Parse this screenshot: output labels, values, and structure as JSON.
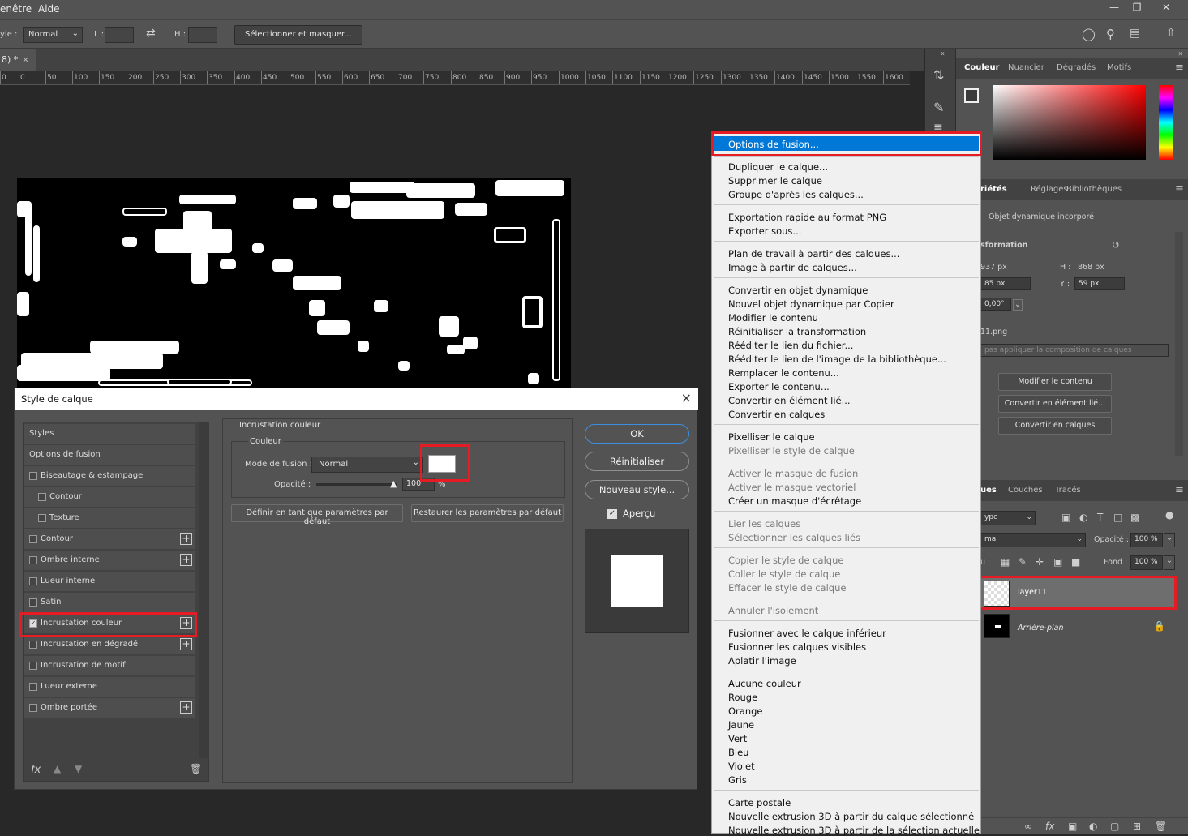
{
  "menubar": {
    "items": [
      "enêtre",
      "Aide"
    ]
  },
  "optionsbar": {
    "style_label": "yle :",
    "style_value": "Normal",
    "w_label": "L :",
    "h_label": "H :",
    "select_mask_button": "Sélectionner et masquer..."
  },
  "document": {
    "tab_title": "8) *",
    "tab_close": "×"
  },
  "ruler": {
    "ticks": [
      "0",
      "0",
      "50",
      "100",
      "150",
      "200",
      "250",
      "300",
      "350",
      "400",
      "450",
      "500",
      "550",
      "600",
      "650",
      "700",
      "750",
      "800",
      "850",
      "900",
      "950",
      "1000",
      "1050",
      "1100",
      "1150",
      "1200",
      "1250",
      "1300",
      "1350",
      "1400",
      "1450",
      "1500",
      "1550",
      "1600"
    ]
  },
  "color_panel": {
    "tabs": [
      "Couleur",
      "Nuancier",
      "Dégradés",
      "Motifs"
    ],
    "active": "Couleur"
  },
  "properties_panel": {
    "tabs": [
      "riétés",
      "Réglages",
      "Bibliothèques"
    ],
    "object_type": "Objet dynamique incorporé",
    "section": "sformation",
    "w_value": "937 px",
    "h_label": "H :",
    "h_value": "868 px",
    "x_value": "85 px",
    "y_label": "Y :",
    "y_value": "59 px",
    "angle_value": "0,00°",
    "filename": "11.png",
    "comp_placeholder": "pas appliquer la composition de calques",
    "btn_edit": "Modifier le contenu",
    "btn_convert_linked": "Convertir en élément lié...",
    "btn_convert_layers": "Convertir en calques"
  },
  "layers_panel": {
    "tabs": [
      "ues",
      "Couches",
      "Tracés"
    ],
    "filter_value": "ype",
    "blend_value": "mal",
    "opacity_label": "Opacité :",
    "opacity_value": "100 %",
    "lock_label": "u :",
    "fill_label": "Fond :",
    "fill_value": "100 %",
    "layers": [
      {
        "name": "layer11"
      },
      {
        "name": "Arrière-plan"
      }
    ]
  },
  "context_menu": {
    "items": [
      {
        "label": "Options de fusion...",
        "top": 0
      },
      {
        "label": "Dupliquer le calque..."
      },
      {
        "label": "Supprimer le calque"
      },
      {
        "label": "Groupe d'après les calques..."
      },
      {
        "label": "Exportation rapide au format PNG"
      },
      {
        "label": "Exporter sous..."
      },
      {
        "label": "Plan de travail à partir des calques..."
      },
      {
        "label": "Image à partir de calques..."
      },
      {
        "label": "Convertir en objet dynamique"
      },
      {
        "label": "Nouvel objet dynamique par Copier"
      },
      {
        "label": "Modifier le contenu"
      },
      {
        "label": "Réinitialiser la transformation"
      },
      {
        "label": "Rééditer le lien du fichier..."
      },
      {
        "label": "Rééditer le lien de l'image de la bibliothèque..."
      },
      {
        "label": "Remplacer le contenu..."
      },
      {
        "label": "Exporter le contenu..."
      },
      {
        "label": "Convertir en élément lié..."
      },
      {
        "label": "Convertir en calques"
      },
      {
        "label": "Pixelliser le calque"
      },
      {
        "label": "Pixelliser le style de calque"
      },
      {
        "label": "Activer le masque de fusion"
      },
      {
        "label": "Activer le masque vectoriel"
      },
      {
        "label": "Créer un masque d'écrêtage"
      },
      {
        "label": "Lier les calques"
      },
      {
        "label": "Sélectionner les calques liés"
      },
      {
        "label": "Copier le style de calque"
      },
      {
        "label": "Coller le style de calque"
      },
      {
        "label": "Effacer le style de calque"
      },
      {
        "label": "Annuler l'isolement"
      },
      {
        "label": "Fusionner avec le calque inférieur"
      },
      {
        "label": "Fusionner les calques visibles"
      },
      {
        "label": "Aplatir l'image"
      },
      {
        "label": "Aucune couleur"
      },
      {
        "label": "Rouge"
      },
      {
        "label": "Orange"
      },
      {
        "label": "Jaune"
      },
      {
        "label": "Vert"
      },
      {
        "label": "Bleu"
      },
      {
        "label": "Violet"
      },
      {
        "label": "Gris"
      },
      {
        "label": "Carte postale"
      },
      {
        "label": "Nouvelle extrusion 3D à partir du calque sélectionné"
      },
      {
        "label": "Nouvelle extrusion 3D à partir de la sélection actuelle"
      }
    ]
  },
  "dialog": {
    "title": "Style de calque",
    "close": "×",
    "styles": [
      "Styles",
      "Options de fusion",
      "Biseautage & estampage",
      "Contour",
      "Texture",
      "Contour",
      "Ombre interne",
      "Lueur interne",
      "Satin",
      "Incrustation couleur",
      "Incrustation en dégradé",
      "Incrustation de motif",
      "Lueur externe",
      "Ombre portée"
    ],
    "section_title": "Incrustation couleur",
    "group_title": "Couleur",
    "blend_label": "Mode de fusion :",
    "blend_value": "Normal",
    "opacity_label": "Opacité :",
    "opacity_value": "100",
    "opacity_unit": "%",
    "btn_default": "Définir en tant que paramètres par défaut",
    "btn_restore": "Restaurer les paramètres par défaut",
    "ok": "OK",
    "reset": "Réinitialiser",
    "new_style": "Nouveau style...",
    "preview_label": "Aperçu",
    "fx": "fx",
    "overlay_color": "#ffffff"
  }
}
